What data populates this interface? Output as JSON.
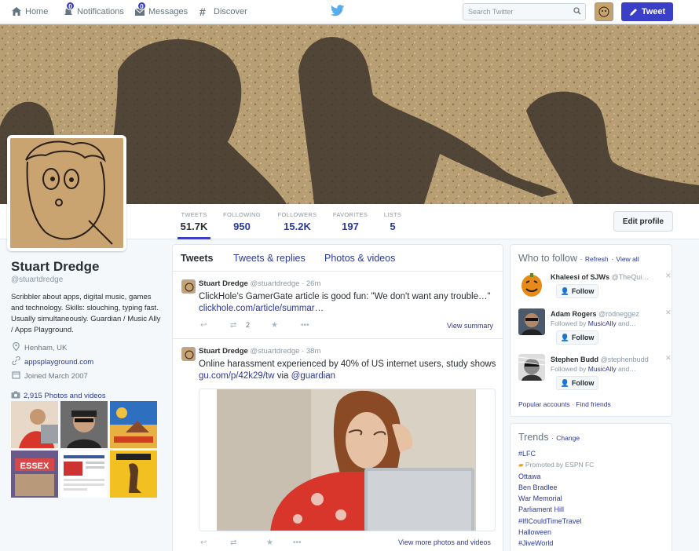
{
  "nav": {
    "home": "Home",
    "notifications": "Notifications",
    "notifications_count": "0",
    "messages": "Messages",
    "messages_count": "0",
    "discover": "Discover",
    "search_placeholder": "Search Twitter",
    "tweet_button": "Tweet"
  },
  "stats": [
    {
      "label": "TWEETS",
      "value": "51.7K"
    },
    {
      "label": "FOLLOWING",
      "value": "950"
    },
    {
      "label": "FOLLOWERS",
      "value": "15.2K"
    },
    {
      "label": "FAVORITES",
      "value": "197"
    },
    {
      "label": "LISTS",
      "value": "5"
    }
  ],
  "edit_profile": "Edit profile",
  "profile": {
    "name": "Stuart Dredge",
    "handle": "@stuartdredge",
    "bio": "Scribbler about apps, digital music, games and technology. Skills: slouching, typing fast. Usually simultaneously. Guardian / Music Ally / Apps Playground.",
    "location": "Henham, UK",
    "website": "appsplayground.com",
    "joined": "Joined March 2007",
    "photos_label": "2,915 Photos and videos"
  },
  "timeline": {
    "tabs": [
      "Tweets",
      "Tweets & replies",
      "Photos & videos"
    ],
    "tweets": [
      {
        "name": "Stuart Dredge",
        "meta": "@stuartdredge · 26m",
        "text": "ClickHole's GamerGate article is good fun: \"We don't want any trouble…\"",
        "link": "clickhole.com/article/summar…",
        "retweets": "2",
        "view": "View summary"
      },
      {
        "name": "Stuart Dredge",
        "meta": "@stuartdredge · 38m",
        "text": "Online harassment experienced by 40% of US internet users, study shows",
        "link": "gu.com/p/42k29/tw",
        "via": "via",
        "mention": "@guardian",
        "view": "View more photos and videos"
      }
    ]
  },
  "who_to_follow": {
    "title": "Who to follow",
    "refresh": "Refresh",
    "view_all": "View all",
    "follow_label": "Follow",
    "users": [
      {
        "name": "Khaleesi of SJWs",
        "handle": "@TheQui…",
        "sub": ""
      },
      {
        "name": "Adam Rogers",
        "handle": "@rodneggez",
        "sub_prefix": "Followed by",
        "sub_link": "MusicAlly",
        "sub_suffix": "and…"
      },
      {
        "name": "Stephen Budd",
        "handle": "@stephenbudd",
        "sub_prefix": "Followed by",
        "sub_link": "MusicAlly",
        "sub_suffix": "and…"
      }
    ],
    "popular": "Popular accounts",
    "find_friends": "Find friends"
  },
  "trends": {
    "title": "Trends",
    "change": "Change",
    "items": [
      "#LFC",
      "Promoted by ESPN FC",
      "Ottawa",
      "Ben Bradlee",
      "War Memorial",
      "Parliament Hill",
      "#IfICouldTimeTravel",
      "Halloween",
      "#JiveWorld"
    ]
  },
  "colors": {
    "accent": "#3b3fc8",
    "link": "#2b3a9a"
  }
}
